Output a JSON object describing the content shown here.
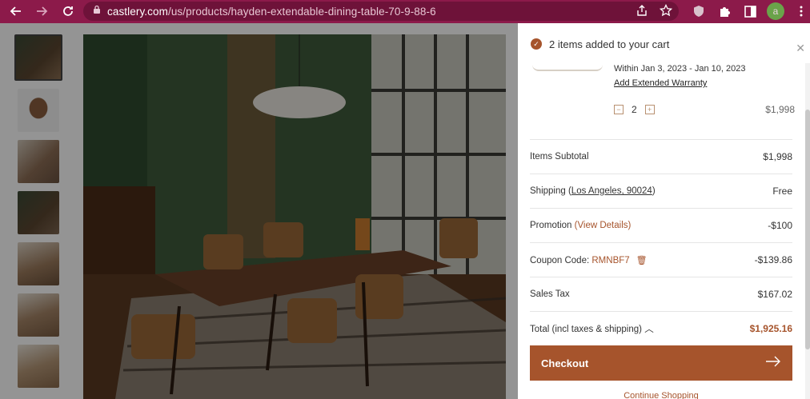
{
  "browser": {
    "url_host": "castlery.com",
    "url_path": "/us/products/hayden-extendable-dining-table-70-9-88-6",
    "avatar_letter": "a"
  },
  "cart": {
    "title": "2 items added to your cart",
    "delivery": "Within Jan 3, 2023 - Jan 10, 2023",
    "warranty_link": "Add Extended Warranty",
    "quantity": "2",
    "item_price": "$1,998",
    "summary": {
      "subtotal_label": "Items Subtotal",
      "subtotal_value": "$1,998",
      "shipping_label": "Shipping (",
      "shipping_location": "Los Angeles, 90024",
      "shipping_close": ")",
      "shipping_value": "Free",
      "promotion_label": "Promotion ",
      "promotion_link": "(View Details)",
      "promotion_value": "-$100",
      "coupon_label": "Coupon Code: ",
      "coupon_code": "RMNBF7",
      "coupon_value": "-$139.86",
      "tax_label": "Sales Tax",
      "tax_value": "$167.02",
      "total_label": "Total (incl taxes & shipping)",
      "total_value": "$1,925.16"
    },
    "checkout_label": "Checkout",
    "continue_label": "Continue Shopping"
  },
  "colors": {
    "accent": "#a6542c",
    "browser": "#8c1a4a"
  }
}
